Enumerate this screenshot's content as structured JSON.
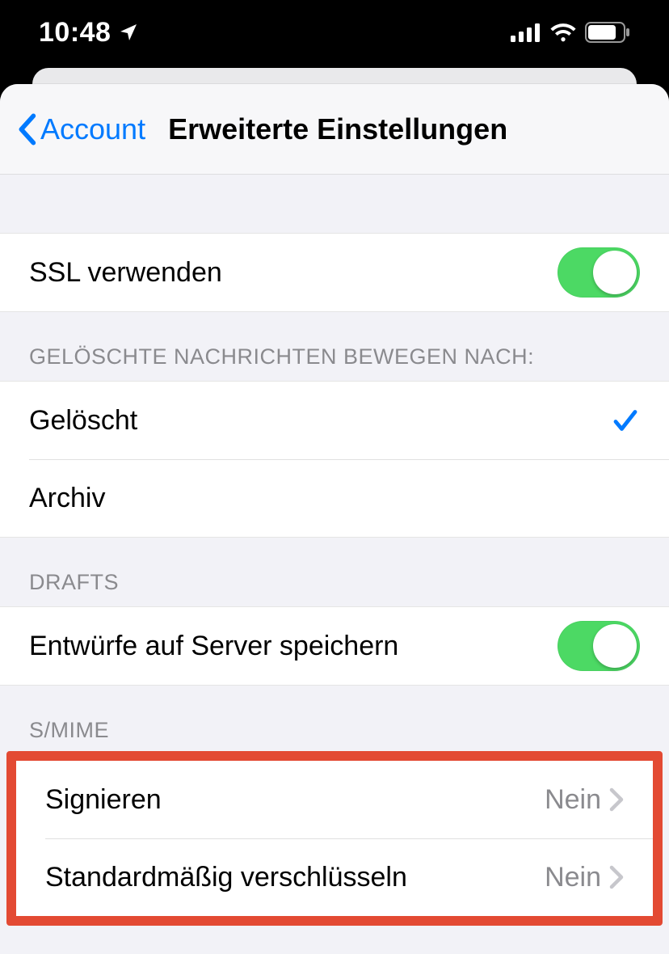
{
  "status": {
    "time": "10:48"
  },
  "nav": {
    "back": "Account",
    "title": "Erweiterte Einstellungen"
  },
  "ssl": {
    "label": "SSL verwenden",
    "on": true
  },
  "deleted": {
    "header": "GELÖSCHTE NACHRICHTEN BEWEGEN NACH:",
    "options": [
      {
        "label": "Gelöscht",
        "selected": true
      },
      {
        "label": "Archiv",
        "selected": false
      }
    ]
  },
  "drafts": {
    "header": "DRAFTS",
    "label": "Entwürfe auf Server speichern",
    "on": true
  },
  "smime": {
    "header": "S/MIME",
    "rows": [
      {
        "label": "Signieren",
        "value": "Nein"
      },
      {
        "label": "Standardmäßig verschlüsseln",
        "value": "Nein"
      }
    ]
  }
}
